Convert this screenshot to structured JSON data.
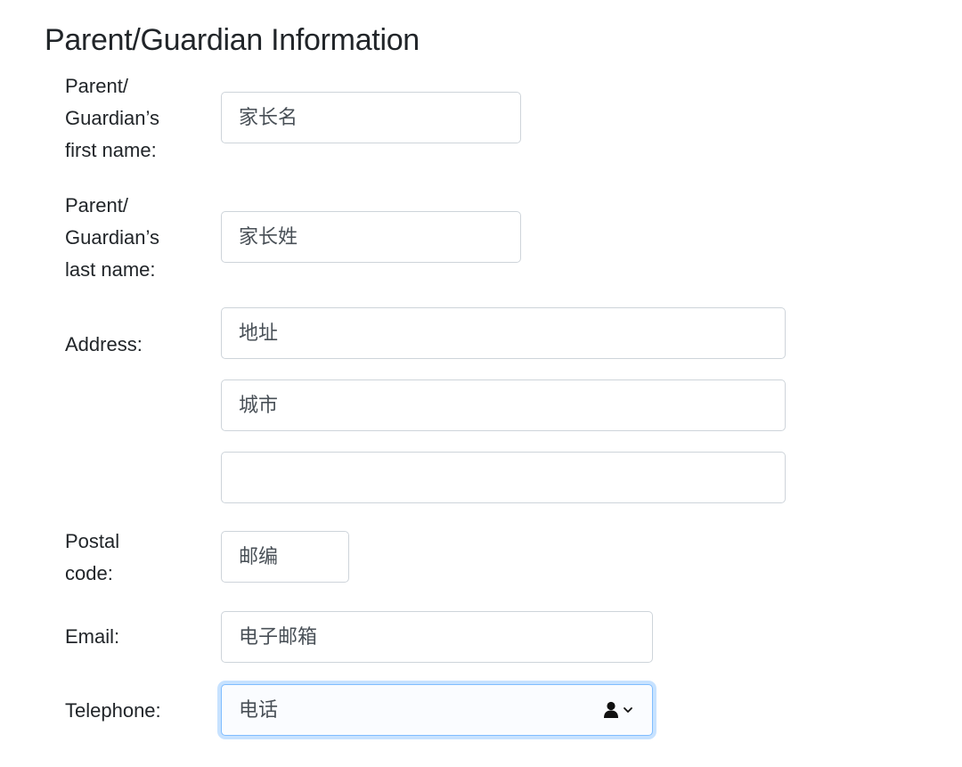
{
  "section": {
    "title": "Parent/Guardian Information"
  },
  "fields": {
    "first_name": {
      "label": "Parent/\nGuardian’s\nfirst name:",
      "placeholder": "家长名"
    },
    "last_name": {
      "label": "Parent/\nGuardian’s\nlast name:",
      "placeholder": "家长姓"
    },
    "address": {
      "label": "Address:",
      "line1_placeholder": "地址",
      "city_placeholder": "城市",
      "line3_placeholder": ""
    },
    "postal_code": {
      "label": "Postal\ncode:",
      "placeholder": "邮编"
    },
    "email": {
      "label": "Email:",
      "placeholder": "电子邮箱"
    },
    "telephone": {
      "label": "Telephone:",
      "placeholder": "电话",
      "focused": true
    }
  },
  "icons": {
    "telephone_autofill": "contact-person-icon"
  },
  "colors": {
    "focus_border": "#80bdff",
    "input_border": "#ced4da",
    "text": "#212529"
  }
}
